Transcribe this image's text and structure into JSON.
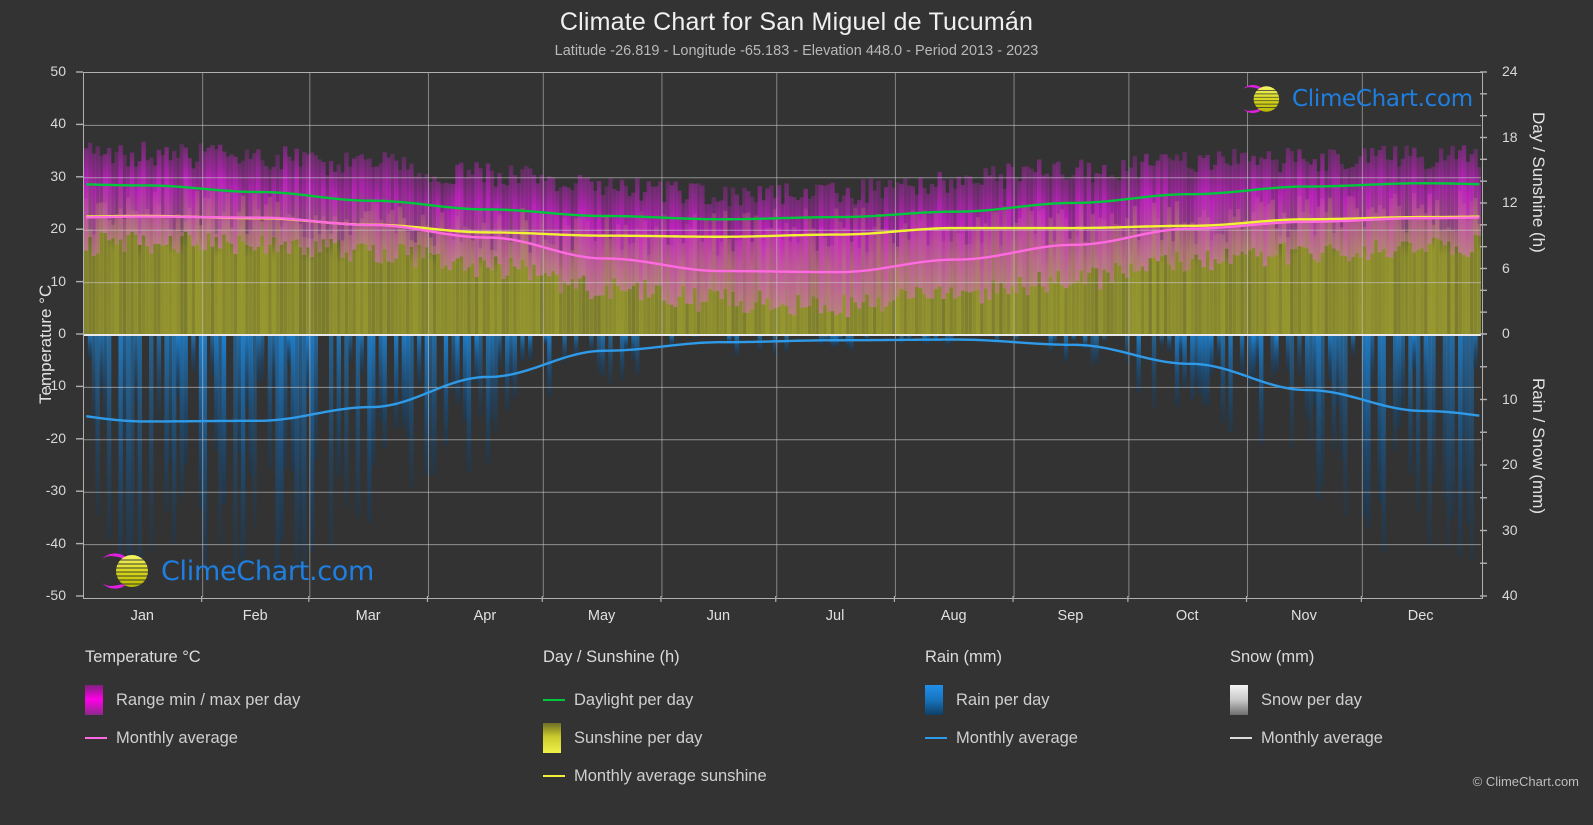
{
  "header": {
    "title": "Climate Chart for San Miguel de Tucumán",
    "subtitle": "Latitude -26.819 - Longitude -65.183 - Elevation 448.0 - Period 2013 - 2023"
  },
  "axes": {
    "left_title": "Temperature °C",
    "right_top_title": "Day / Sunshine (h)",
    "right_bottom_title": "Rain / Snow (mm)",
    "left_ticks": [
      "50",
      "40",
      "30",
      "20",
      "10",
      "0",
      "-10",
      "-20",
      "-30",
      "-40",
      "-50"
    ],
    "right_top_ticks": [
      "24",
      "18",
      "12",
      "6",
      "0"
    ],
    "right_bottom_ticks": [
      "0",
      "10",
      "20",
      "30",
      "40"
    ],
    "months": [
      "Jan",
      "Feb",
      "Mar",
      "Apr",
      "May",
      "Jun",
      "Jul",
      "Aug",
      "Sep",
      "Oct",
      "Nov",
      "Dec"
    ]
  },
  "legend": {
    "groups": [
      {
        "title": "Temperature °C",
        "items": [
          {
            "label": "Range min / max per day",
            "marker": "gradient-box",
            "color": "#ff00e0"
          },
          {
            "label": "Monthly average",
            "marker": "line",
            "color": "#ff6ae0"
          }
        ]
      },
      {
        "title": "Day / Sunshine (h)",
        "items": [
          {
            "label": "Daylight per day",
            "marker": "line",
            "color": "#00c83c"
          },
          {
            "label": "Sunshine per day",
            "marker": "gradient-box",
            "color": "#eded3a"
          },
          {
            "label": "Monthly average sunshine",
            "marker": "line",
            "color": "#f2f235"
          }
        ]
      },
      {
        "title": "Rain (mm)",
        "items": [
          {
            "label": "Rain per day",
            "marker": "gradient-box",
            "color": "#1488e0"
          },
          {
            "label": "Monthly average",
            "marker": "line",
            "color": "#2f9ae8"
          }
        ]
      },
      {
        "title": "Snow (mm)",
        "items": [
          {
            "label": "Snow per day",
            "marker": "gradient-box",
            "color": "#e8e8e8"
          },
          {
            "label": "Monthly average",
            "marker": "line",
            "color": "#dcdcdc"
          }
        ]
      }
    ]
  },
  "watermark": {
    "text": "ClimeChart.com"
  },
  "copyright": "© ClimeChart.com",
  "chart_data": {
    "type": "area",
    "title": "Climate Chart for San Miguel de Tucumán",
    "subtitle": "Latitude -26.819 - Longitude -65.183 - Elevation 448.0 - Period 2013 - 2023",
    "xlabel": "",
    "ylabel": "Temperature °C",
    "y_left_label": "Temperature °C",
    "y_left_lim": [
      -50,
      50
    ],
    "y_left_ticks": [
      50,
      40,
      30,
      20,
      10,
      0,
      -10,
      -20,
      -30,
      -40,
      -50
    ],
    "y_right_top_label": "Day / Sunshine (h)",
    "y_right_top_lim": [
      0,
      24
    ],
    "y_right_top_ticks": [
      24,
      18,
      12,
      6,
      0
    ],
    "y_right_bottom_label": "Rain / Snow (mm)",
    "y_right_bottom_lim": [
      0,
      40
    ],
    "y_right_bottom_ticks": [
      0,
      10,
      20,
      30,
      40
    ],
    "grid": true,
    "legend_position": "below",
    "categories": [
      "Jan",
      "Feb",
      "Mar",
      "Apr",
      "May",
      "Jun",
      "Jul",
      "Aug",
      "Sep",
      "Oct",
      "Nov",
      "Dec"
    ],
    "series": [
      {
        "name": "Monthly average temperature",
        "unit": "°C",
        "color": "#ff6ae0",
        "type": "line",
        "values": [
          22.6,
          22.4,
          21.0,
          18.6,
          14.6,
          12.2,
          12.0,
          14.4,
          17.2,
          20.3,
          21.6,
          22.3
        ]
      },
      {
        "name": "Daily maximum temperature (range top)",
        "unit": "°C",
        "color": "#bd00bd",
        "type": "range",
        "values": [
          34.5,
          34.0,
          32.5,
          30.5,
          28.0,
          26.5,
          27.0,
          29.5,
          31.5,
          33.0,
          33.5,
          34.0
        ]
      },
      {
        "name": "Daily minimum temperature (range bottom)",
        "unit": "°C",
        "color": "#bd00bd",
        "type": "range",
        "values": [
          17.5,
          17.3,
          16.0,
          13.0,
          9.0,
          6.5,
          5.5,
          7.5,
          10.5,
          14.0,
          15.8,
          17.0
        ]
      },
      {
        "name": "Daylight per day",
        "unit": "h",
        "color": "#00c83c",
        "type": "line",
        "values": [
          13.7,
          13.1,
          12.3,
          11.5,
          10.9,
          10.6,
          10.8,
          11.3,
          12.1,
          12.9,
          13.6,
          13.9
        ]
      },
      {
        "name": "Monthly average sunshine",
        "unit": "h",
        "color": "#f2f235",
        "type": "line",
        "values": [
          10.9,
          10.7,
          10.1,
          9.4,
          9.1,
          9.0,
          9.2,
          9.8,
          9.8,
          10.0,
          10.6,
          10.8
        ]
      },
      {
        "name": "Monthly average rain",
        "unit": "mm",
        "color": "#2f9ae8",
        "type": "line",
        "values": [
          13.2,
          13.1,
          11.0,
          6.4,
          2.4,
          1.1,
          0.8,
          0.7,
          1.5,
          4.4,
          8.4,
          11.6
        ]
      },
      {
        "name": "Monthly average snow",
        "unit": "mm",
        "color": "#dcdcdc",
        "type": "line",
        "values": [
          0,
          0,
          0,
          0,
          0,
          0,
          0,
          0,
          0,
          0,
          0,
          0
        ]
      }
    ]
  }
}
